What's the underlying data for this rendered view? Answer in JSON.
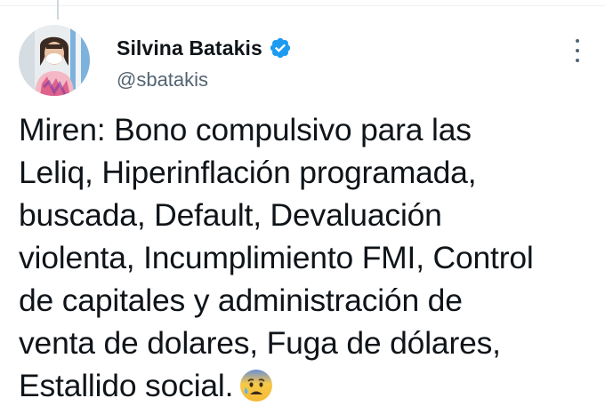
{
  "author": {
    "name": "Silvina Batakis",
    "handle": "@sbatakis",
    "verified_icon": "verified-badge-icon",
    "avatar_icon": "avatar-photo"
  },
  "tweet": {
    "text": "Miren: Bono compulsivo para las\nLeliq, Hiperinflación programada,\nbuscada, Default, Devaluación\nviolenta, Incumplimiento FMI, Control\nde capitales y administración de\nventa de dolares, Fuga de dólares,\nEstallido social.",
    "emoji": "anxious-face-with-sweat"
  },
  "menu": {
    "icon": "more-vertical-icon"
  },
  "colors": {
    "text": "#0f1419",
    "secondary": "#536471",
    "verified": "#1d9bf0",
    "divider": "#eff3f4"
  }
}
